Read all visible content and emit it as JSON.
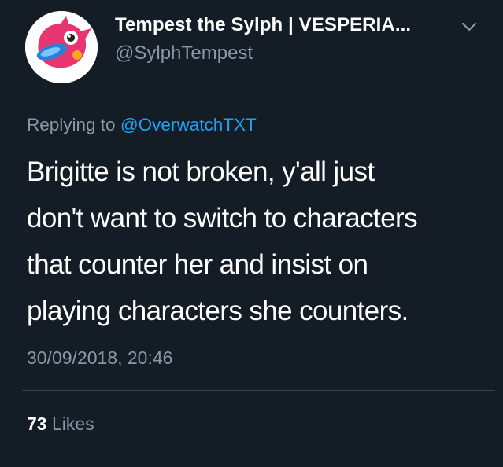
{
  "user": {
    "display_name": "Tempest the Sylph | VESPERIA...",
    "handle": "@SylphTempest",
    "avatar_icon": "rotom-pokedex-avatar-icon"
  },
  "reply": {
    "prefix": "Replying to",
    "mention": "@OverwatchTXT"
  },
  "tweet": {
    "lines": [
      "Brigitte is not broken, y'all just",
      "don't want to switch to characters",
      "that counter her and insist on",
      "playing characters she counters."
    ],
    "timestamp": "30/09/2018, 20:46"
  },
  "stats": {
    "likes_count": "73",
    "likes_label": "Likes"
  },
  "colors": {
    "background": "#141d26",
    "text_primary": "#ffffff",
    "text_secondary": "#8899a6",
    "link": "#1da1f2",
    "divider": "#38444d"
  }
}
